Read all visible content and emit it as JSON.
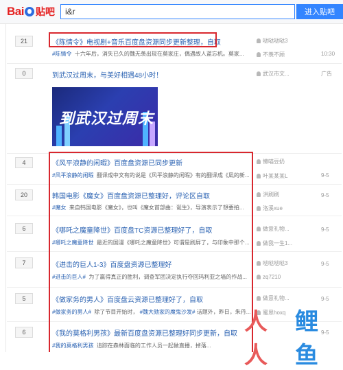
{
  "header": {
    "logo_bai": "Bai",
    "logo_tieba": "贴吧",
    "search_value": "i&r",
    "enter_label": "进入贴吧"
  },
  "threads": [
    {
      "replies": "21",
      "title": "《陈情令》电视剧+音乐百度盘资源同步更新整理，自取",
      "tag": "#陈情令",
      "desc": "十六年后，消失已久的魏无羡出现在莫家庄，偶遇故人蓝忘机。莫家...",
      "author1": "哒哒哒哒3",
      "author2": "不羡不顾",
      "time": "10:30"
    },
    {
      "replies": "0",
      "title": "到武汉过周末，与美好相遇48小时！",
      "author1": "武汉市文...",
      "ad": "广告",
      "ad_slogan": "到武汉过周末"
    },
    {
      "replies": "4",
      "title": "《风平浪静的闲暇》百度盘资源已同步更新",
      "tag": "#风平浪静的闲暇",
      "desc": "翻译成中文有的说是《风平浪静的闲暇》有的翻译成《凪的新...",
      "author1": "懒喵豆奶",
      "author2": "叶某某某L",
      "time": "9-5"
    },
    {
      "replies": "20",
      "title": "韩国电影《魔女》百度盘资源已整理好，评论区自取",
      "tag": "#魔女",
      "desc": "来自韩国电影《魔女》，也叫《魔女首部曲：诞生》，导演表示了想要拍...",
      "author1": "洪刷刷",
      "author2": "洛溪xue",
      "time": "9-5"
    },
    {
      "replies": "6",
      "title": "《哪吒之魔童降世》百度盘TC资源已整理好了，自取",
      "tag": "#哪吒之魔童降世",
      "desc": "最近的国漫《哪吒之魔童降世》可谓是刷屏了，与印象中那个...",
      "author1": "做意礼物...",
      "author2": "做我一生1...",
      "time": "9-5"
    },
    {
      "replies": "7",
      "title": "《进击的巨人1-3》百度盘资源已整理好",
      "tag": "#进击的巨人#",
      "desc": "为了赢得真正的胜利，调查军团决定执行夺回玛利亚之墙的作战...",
      "author1": "哒哒哒哒3",
      "author2": "zq7210",
      "time": "9-5"
    },
    {
      "replies": "5",
      "title": "《做家务的男人》百度盘云资源已整理好了，自取",
      "tag": "#做家务的男人#",
      "desc": "除了节目开始时，",
      "tag2": "#魏大勋家的魔鬼沙发#",
      "desc2": "话题外，昨日，朱丹...",
      "author1": "做意礼物...",
      "author2": "蜜思hoxq",
      "time": "9-5"
    },
    {
      "replies": "6",
      "title": "《我的莫格利男孩》最新百度盘资源已整理好同步更新，自取",
      "tag": "#我的莫格利男孩",
      "desc": "追踪在森林面临的工作人员一起做直播，掉落...",
      "time": "9-5"
    }
  ],
  "watermark": {
    "w1": "人人",
    "w2": "鲤鱼"
  },
  "colors": {
    "highlight": "#d8272e",
    "link": "#2d64b3",
    "brand_blue": "#3385ff"
  }
}
